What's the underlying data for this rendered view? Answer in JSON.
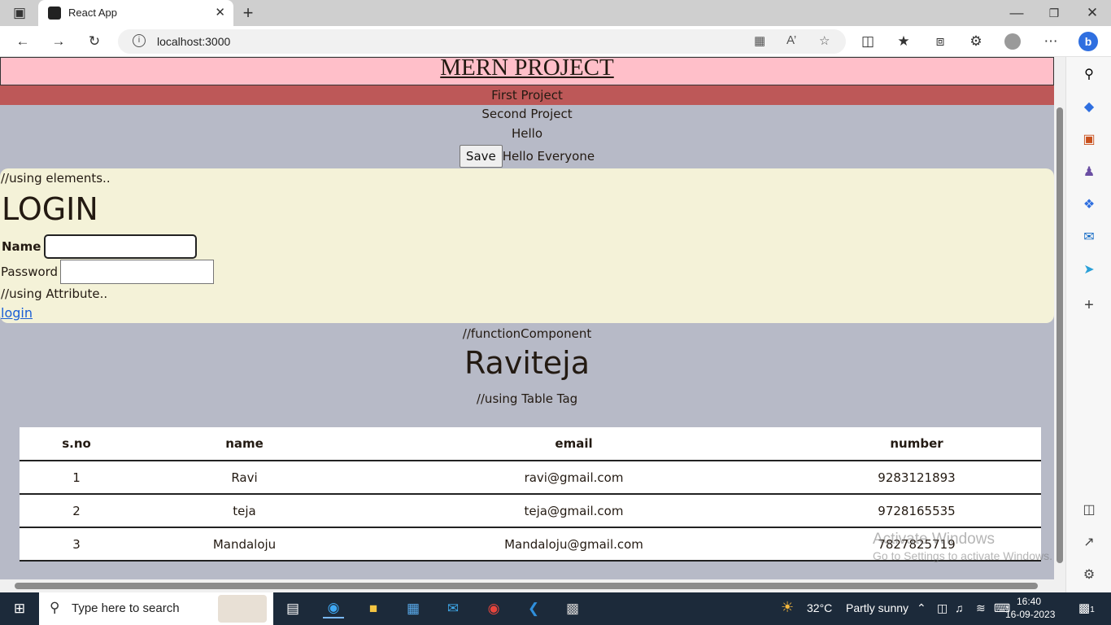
{
  "browser": {
    "tab_title": "React App",
    "url": "localhost:3000"
  },
  "page": {
    "header_title": "MERN PROJECT",
    "first_project": "First Project",
    "second_project": "Second Project",
    "hello": "Hello",
    "save_button": "Save",
    "hello_everyone": "Hello Everyone",
    "using_elements": "//using elements..",
    "login_heading": "LOGIN",
    "name_label": "Name :",
    "password_label": "Password :",
    "using_attribute": "//using Attribute..",
    "login_link": "login",
    "function_component": "//functionComponent",
    "name_heading": "Raviteja",
    "using_table": "//using Table Tag"
  },
  "table": {
    "headers": [
      "s.no",
      "name",
      "email",
      "number"
    ],
    "rows": [
      [
        "1",
        "Ravi",
        "ravi@gmail.com",
        "9283121893"
      ],
      [
        "2",
        "teja",
        "teja@gmail.com",
        "9728165535"
      ],
      [
        "3",
        "Mandaloju",
        "Mandaloju@gmail.com",
        "7827825719"
      ]
    ]
  },
  "watermark": {
    "line1": "Activate Windows",
    "line2": "Go to Settings to activate Windows."
  },
  "taskbar": {
    "search_placeholder": "Type here to search",
    "weather_temp": "32°C",
    "weather_text": "Partly sunny",
    "time": "16:40",
    "date": "16-09-2023",
    "notification_count": "1"
  },
  "colors": {
    "header_bg": "#ffbfc9",
    "first_project_bg": "#bd5858",
    "page_bg": "#b7bac7",
    "login_bg": "#f4f2d8",
    "taskbar_bg": "#1c2a3a"
  }
}
